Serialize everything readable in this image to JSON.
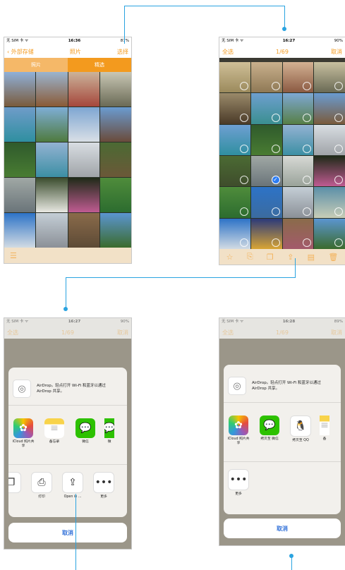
{
  "colors": {
    "accent": "#f39a1e",
    "connector": "#2aa3e0",
    "select_check": "#2b7cf4",
    "cancel_text": "#2f6fd8"
  },
  "screen1": {
    "status": {
      "carrier": "无 SIM 卡 ᯤ",
      "time": "16:36",
      "battery": "87%"
    },
    "nav": {
      "back": "外部存储",
      "title": "照片",
      "action": "选择"
    },
    "segments": [
      "照片",
      "精选"
    ],
    "toolbar_icon": "list-icon"
  },
  "screen2": {
    "status": {
      "carrier": "无 SIM 卡 ᯤ",
      "time": "16:27",
      "battery": "90%"
    },
    "nav": {
      "left": "全选",
      "title": "1/69",
      "right": "取消"
    },
    "toolbar_icons": [
      "star-icon",
      "export-icon",
      "copy-icon",
      "share-icon",
      "album-icon",
      "trash-icon"
    ]
  },
  "screen3": {
    "status": {
      "carrier": "无 SIM 卡 ᯤ",
      "time": "16:27",
      "battery": "90%"
    },
    "nav": {
      "left": "全选",
      "title": "1/69",
      "right": "取消"
    },
    "airdrop_text": "AirDrop。轻点打开 Wi-Fi 和蓝牙以通过 AirDrop 共享。",
    "apps": [
      {
        "label": "iCloud 照片共享",
        "icon": "photos-icon"
      },
      {
        "label": "备忘录",
        "icon": "notes-icon"
      },
      {
        "label": "微信",
        "icon": "wechat-icon"
      },
      {
        "label": "微",
        "icon": "wechat-icon"
      }
    ],
    "actions": [
      {
        "label": "",
        "icon": "copy-icon"
      },
      {
        "label": "打印",
        "icon": "print-icon"
      },
      {
        "label": "Open in ...",
        "icon": "open-in-icon"
      },
      {
        "label": "更多",
        "icon": "more-icon"
      }
    ],
    "cancel": "取消"
  },
  "screen4": {
    "status": {
      "carrier": "无 SIM 卡 ᯤ",
      "time": "16:28",
      "battery": "89%"
    },
    "nav": {
      "left": "全选",
      "title": "1/69",
      "right": "取消"
    },
    "airdrop_text": "AirDrop。轻点打开 Wi-Fi 和蓝牙以通过 AirDrop 共享。",
    "apps": [
      {
        "label": "iCloud 照片共享",
        "icon": "photos-icon"
      },
      {
        "label": "拷贝至 微信",
        "icon": "wechat-icon"
      },
      {
        "label": "拷贝至 QQ",
        "icon": "qq-icon"
      },
      {
        "label": "备",
        "icon": "notes-icon"
      }
    ],
    "actions": [
      {
        "label": "更多",
        "icon": "more-icon"
      }
    ],
    "cancel": "取消"
  }
}
